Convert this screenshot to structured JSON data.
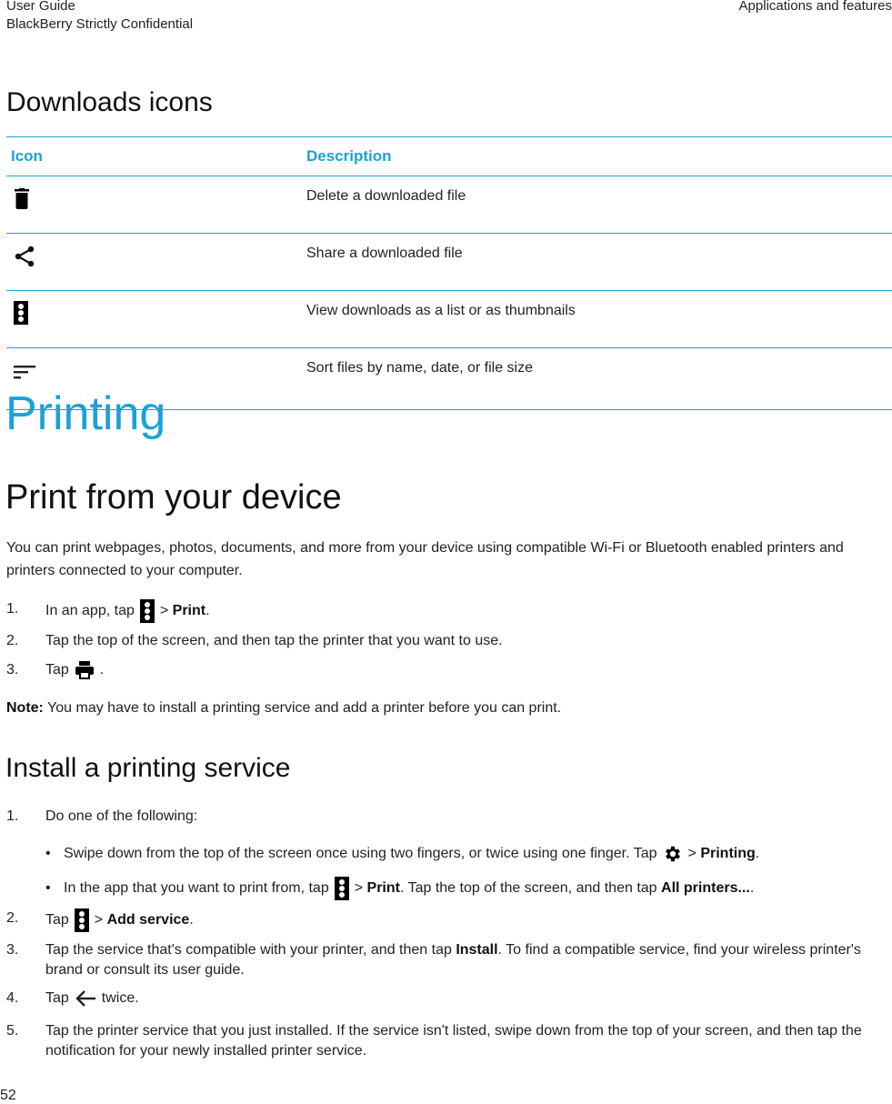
{
  "header": {
    "left_line1": "User Guide",
    "left_line2": "BlackBerry Strictly Confidential",
    "right": "Applications and features"
  },
  "downloads": {
    "heading": "Downloads icons",
    "table": {
      "col_icon": "Icon",
      "col_description": "Description",
      "rows": [
        {
          "icon": "trash-icon",
          "description": "Delete a downloaded file"
        },
        {
          "icon": "share-icon",
          "description": "Share a downloaded file"
        },
        {
          "icon": "more-vertical-icon",
          "description": "View downloads as a list or as thumbnails"
        },
        {
          "icon": "sort-icon",
          "description": "Sort files by name, date, or file size"
        }
      ]
    }
  },
  "printing": {
    "heading": "Printing",
    "subheading": "Print from your device",
    "intro": "You can print webpages, photos, documents, and more from your device using compatible Wi-Fi or Bluetooth enabled printers and printers connected to your computer.",
    "steps": [
      {
        "num": "1.",
        "pre": "In an app, tap",
        "icon": "more-vertical-icon",
        "sep": ">",
        "bold": "Print",
        "post": "."
      },
      {
        "num": "2.",
        "text": "Tap the top of the screen, and then tap the printer that you want to use."
      },
      {
        "num": "3.",
        "pre": "Tap",
        "icon": "printer-icon",
        "post": "."
      }
    ],
    "note_label": "Note:",
    "note_text": "You may have to install a printing service and add a printer before you can print."
  },
  "install": {
    "heading": "Install a printing service",
    "step1": {
      "num": "1.",
      "text": "Do one of the following:"
    },
    "bullets": [
      {
        "pre": "Swipe down from the top of the screen once using two fingers, or twice using one finger. Tap",
        "icon": "settings-gear-icon",
        "sep": ">",
        "bold": "Printing",
        "post": "."
      },
      {
        "pre": "In the app that you want to print from, tap",
        "icon": "more-vertical-icon",
        "sep": ">",
        "bold": "Print",
        "mid": ". Tap the top of the screen, and then tap",
        "bold2": "All printers...",
        "post": "."
      }
    ],
    "step2": {
      "num": "2.",
      "pre": "Tap",
      "sep": ">",
      "bold": "Add service",
      "post": "."
    },
    "step3": {
      "num": "3.",
      "pre": "Tap the service that's compatible with your printer, and then tap",
      "bold": "Install",
      "post": ". To find a compatible service, find your wireless printer's brand or consult its user guide."
    },
    "step4": {
      "num": "4.",
      "pre": "Tap",
      "icon": "back-arrow-icon",
      "post": "twice."
    },
    "step5": {
      "num": "5.",
      "text": "Tap the printer service that you just installed. If the service isn't listed, swipe down from the top of your screen, and then tap the notification for your newly installed printer service."
    }
  },
  "footer": {
    "page_number": "52"
  }
}
